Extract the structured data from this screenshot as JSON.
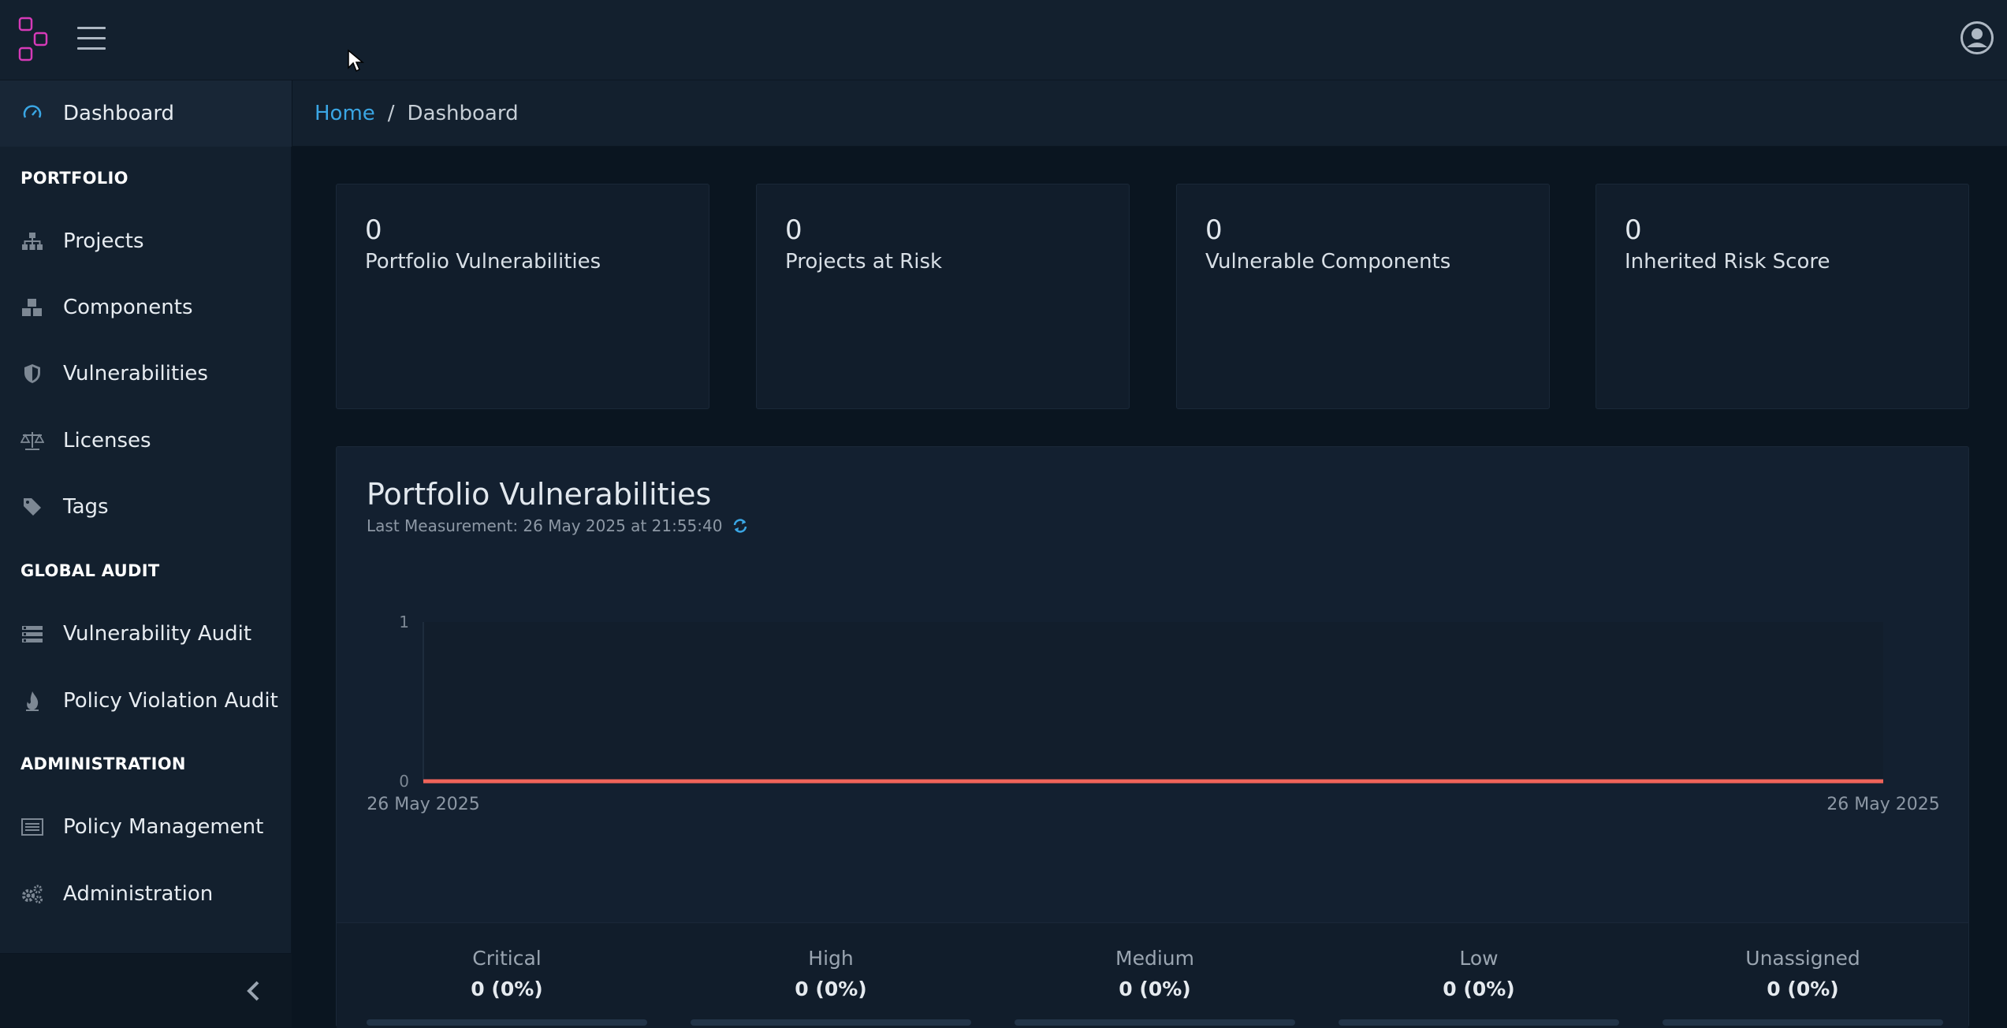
{
  "header": {
    "logo_icon": "dependency-track-logo",
    "menu_icon": "hamburger-icon",
    "user_icon": "user-circle-icon"
  },
  "sidebar": {
    "items": [
      {
        "label": "Dashboard",
        "icon": "speedometer-icon",
        "active": true
      },
      {
        "section": "PORTFOLIO"
      },
      {
        "label": "Projects",
        "icon": "sitemap-icon"
      },
      {
        "label": "Components",
        "icon": "cubes-icon"
      },
      {
        "label": "Vulnerabilities",
        "icon": "shield-icon"
      },
      {
        "label": "Licenses",
        "icon": "balance-scale-icon"
      },
      {
        "label": "Tags",
        "icon": "tag-icon"
      },
      {
        "section": "GLOBAL AUDIT"
      },
      {
        "label": "Vulnerability Audit",
        "icon": "list-icon"
      },
      {
        "label": "Policy Violation Audit",
        "icon": "fire-icon"
      },
      {
        "section": "ADMINISTRATION"
      },
      {
        "label": "Policy Management",
        "icon": "list-alt-icon"
      },
      {
        "label": "Administration",
        "icon": "cogs-icon"
      }
    ],
    "collapse_icon": "chevron-left-icon"
  },
  "breadcrumb": {
    "home": "Home",
    "separator": "/",
    "current": "Dashboard"
  },
  "cards": [
    {
      "value": "0",
      "title": "Portfolio Vulnerabilities"
    },
    {
      "value": "0",
      "title": "Projects at Risk"
    },
    {
      "value": "0",
      "title": "Vulnerable Components"
    },
    {
      "value": "0",
      "title": "Inherited Risk Score"
    }
  ],
  "panel": {
    "title": "Portfolio Vulnerabilities",
    "subtitle": "Last Measurement: 26 May 2025 at 21:55:40",
    "refresh_icon": "refresh-icon"
  },
  "chart_data": {
    "type": "line",
    "x": [
      "26 May 2025",
      "26 May 2025"
    ],
    "series": [
      {
        "values": [
          0,
          0
        ],
        "color": "#f0645a"
      }
    ],
    "ylim": [
      0,
      1
    ],
    "yticks": [
      "1",
      "0"
    ],
    "xticks": [
      "26 May 2025",
      "26 May 2025"
    ],
    "grid": false
  },
  "severity": [
    {
      "name": "Critical",
      "value": "0 (0%)",
      "percent": 0
    },
    {
      "name": "High",
      "value": "0 (0%)",
      "percent": 0
    },
    {
      "name": "Medium",
      "value": "0 (0%)",
      "percent": 0
    },
    {
      "name": "Low",
      "value": "0 (0%)",
      "percent": 0
    },
    {
      "name": "Unassigned",
      "value": "0 (0%)",
      "percent": 0
    }
  ],
  "colors": {
    "accent": "#3aa6e4",
    "line": "#f0645a",
    "logo": "#d63ab8"
  }
}
